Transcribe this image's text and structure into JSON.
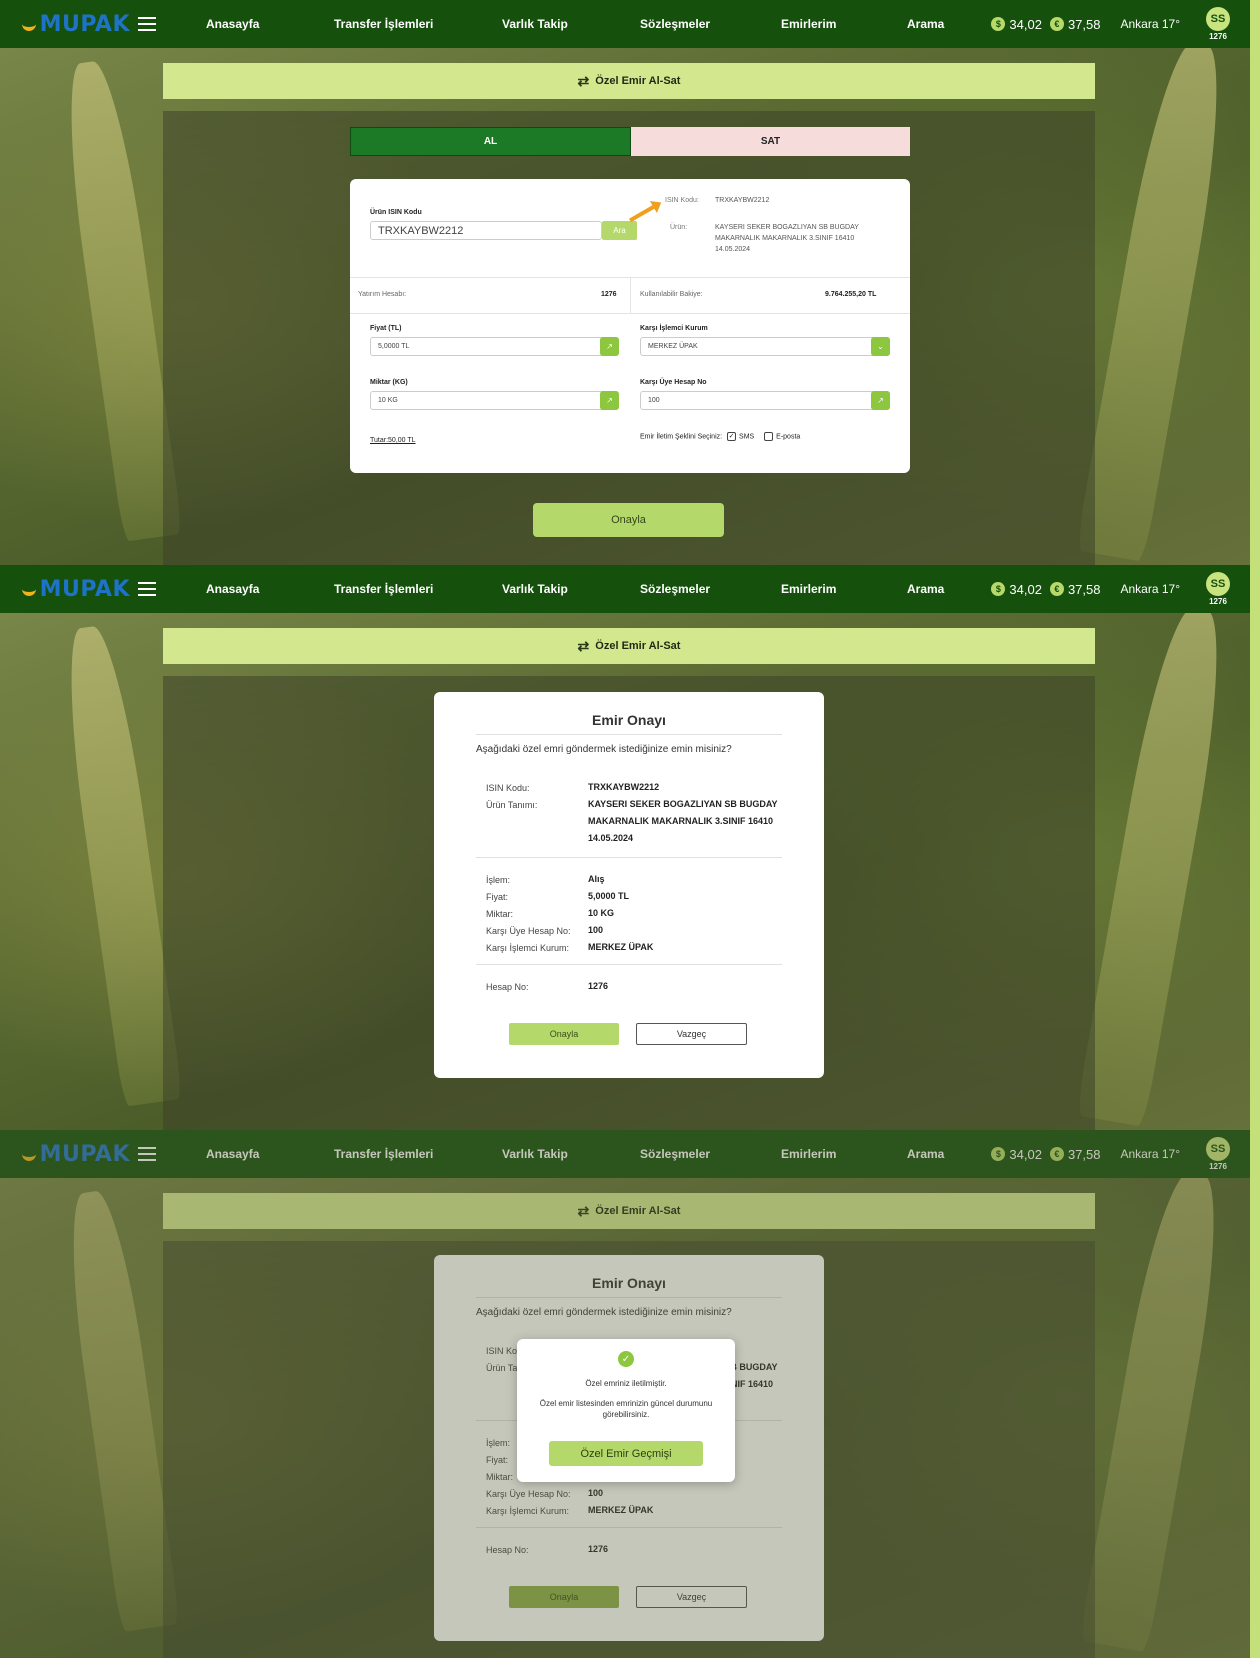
{
  "app": {
    "logo": "MUPAK",
    "nav": [
      "Anasayfa",
      "Transfer İşlemleri",
      "Varlık Takip",
      "Sözleşmeler",
      "Emirlerim",
      "Arama"
    ],
    "usd_rate": "34,02",
    "eur_rate": "37,58",
    "weather": "Ankara 17°",
    "avatar": "SS",
    "account_short": "1276",
    "usd_icon": "$",
    "eur_icon": "€"
  },
  "page_title": "Özel Emir Al-Sat",
  "form": {
    "tab_buy": "AL",
    "tab_sell": "SAT",
    "isin_label": "Ürün ISIN Kodu",
    "isin_value": "TRXKAYBW2212",
    "search_button": "Ara",
    "info_isin_label": "ISIN Kodu:",
    "info_isin_value": "TRXKAYBW2212",
    "info_product_label": "Ürün:",
    "info_product_value": [
      "KAYSERI SEKER BOGAZLIYAN SB BUGDAY",
      "MAKARNALIK MAKARNALIK 3.SINIF 16410",
      "14.05.2024"
    ],
    "investment_account_label": "Yatırım Hesabı:",
    "investment_account_value": "1276",
    "available_balance_label": "Kullanılabilir Bakiye:",
    "available_balance_value": "9.764.255,20 TL",
    "price_label": "Fiyat (TL)",
    "price_value": "5,0000 TL",
    "counter_institution_label": "Karşı İşlemci Kurum",
    "counter_institution_value": "MERKEZ ÜPAK",
    "quantity_label": "Miktar (KG)",
    "quantity_value": "10 KG",
    "counter_account_label": "Karşı Üye Hesap No",
    "counter_account_value": "100",
    "total_label": "Tutar:",
    "total_value": "50,00 TL",
    "channel_label": "Emir İletim Şeklini Seçiniz:",
    "channel_sms": "SMS",
    "channel_email": "E-posta",
    "confirm_button": "Onayla"
  },
  "modal": {
    "title": "Emir Onayı",
    "question": "Aşağıdaki özel emri göndermek istediğinize emin misiniz?",
    "isin_label": "ISIN Kodu:",
    "isin_value": "TRXKAYBW2212",
    "product_label": "Ürün Tanımı:",
    "product_value": [
      "KAYSERI SEKER BOGAZLIYAN SB BUGDAY",
      "MAKARNALIK MAKARNALIK 3.SINIF 16410",
      "14.05.2024"
    ],
    "rows": [
      {
        "label": "İşlem:",
        "value": "Alış"
      },
      {
        "label": "Fiyat:",
        "value": "5,0000 TL"
      },
      {
        "label": "Miktar:",
        "value": "10 KG"
      },
      {
        "label": "Karşı Üye Hesap No:",
        "value": "100"
      },
      {
        "label": "Karşı İşlemci Kurum:",
        "value": "MERKEZ ÜPAK"
      }
    ],
    "account_label": "Hesap No:",
    "account_value": "1276",
    "ok_button": "Onayla",
    "cancel_button": "Vazgeç"
  },
  "toast": {
    "line1": "Özel emriniz iletilmiştir.",
    "line2": "Özel emir listesinden emrinizin güncel durumunu görebilirsiniz.",
    "button": "Özel Emir Geçmişi"
  },
  "colors": {
    "topbar": "#15500d",
    "accent": "#b5d86a",
    "buy_tab": "#1c7a26",
    "sell_tab": "#f7dcdc",
    "logo_blue": "#1e73c8"
  }
}
